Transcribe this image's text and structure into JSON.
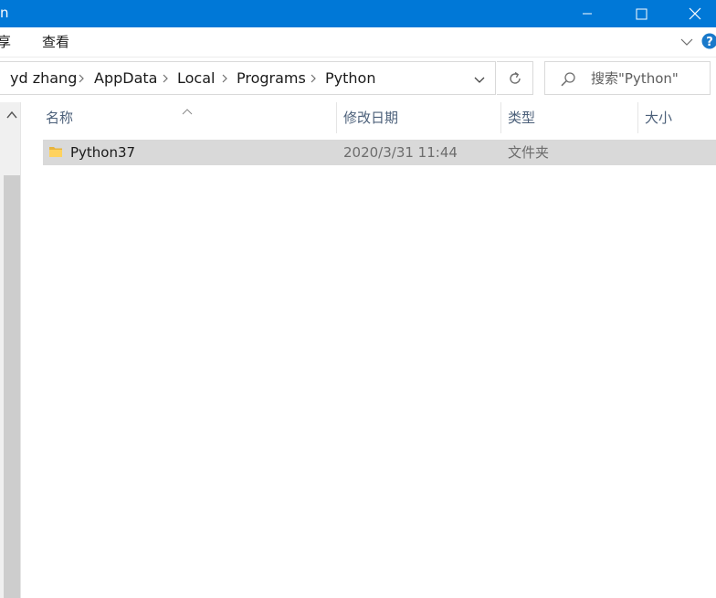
{
  "window": {
    "title": "n"
  },
  "ribbon": {
    "tabs": [
      "享",
      "查看"
    ]
  },
  "address": {
    "crumbs": [
      "yd zhang",
      "AppData",
      "Local",
      "Programs",
      "Python"
    ]
  },
  "search": {
    "placeholder": "搜索\"Python\""
  },
  "columns": {
    "name": "名称",
    "modified": "修改日期",
    "type": "类型",
    "size": "大小"
  },
  "files": [
    {
      "name": "Python37",
      "modified": "2020/3/31 11:44",
      "type": "文件夹",
      "size": "",
      "icon": "folder-icon"
    }
  ],
  "colors": {
    "titlebar": "#0078d7",
    "selected_row": "#d9d9d9",
    "header_text": "#4c607a",
    "help": "#1979ca"
  }
}
